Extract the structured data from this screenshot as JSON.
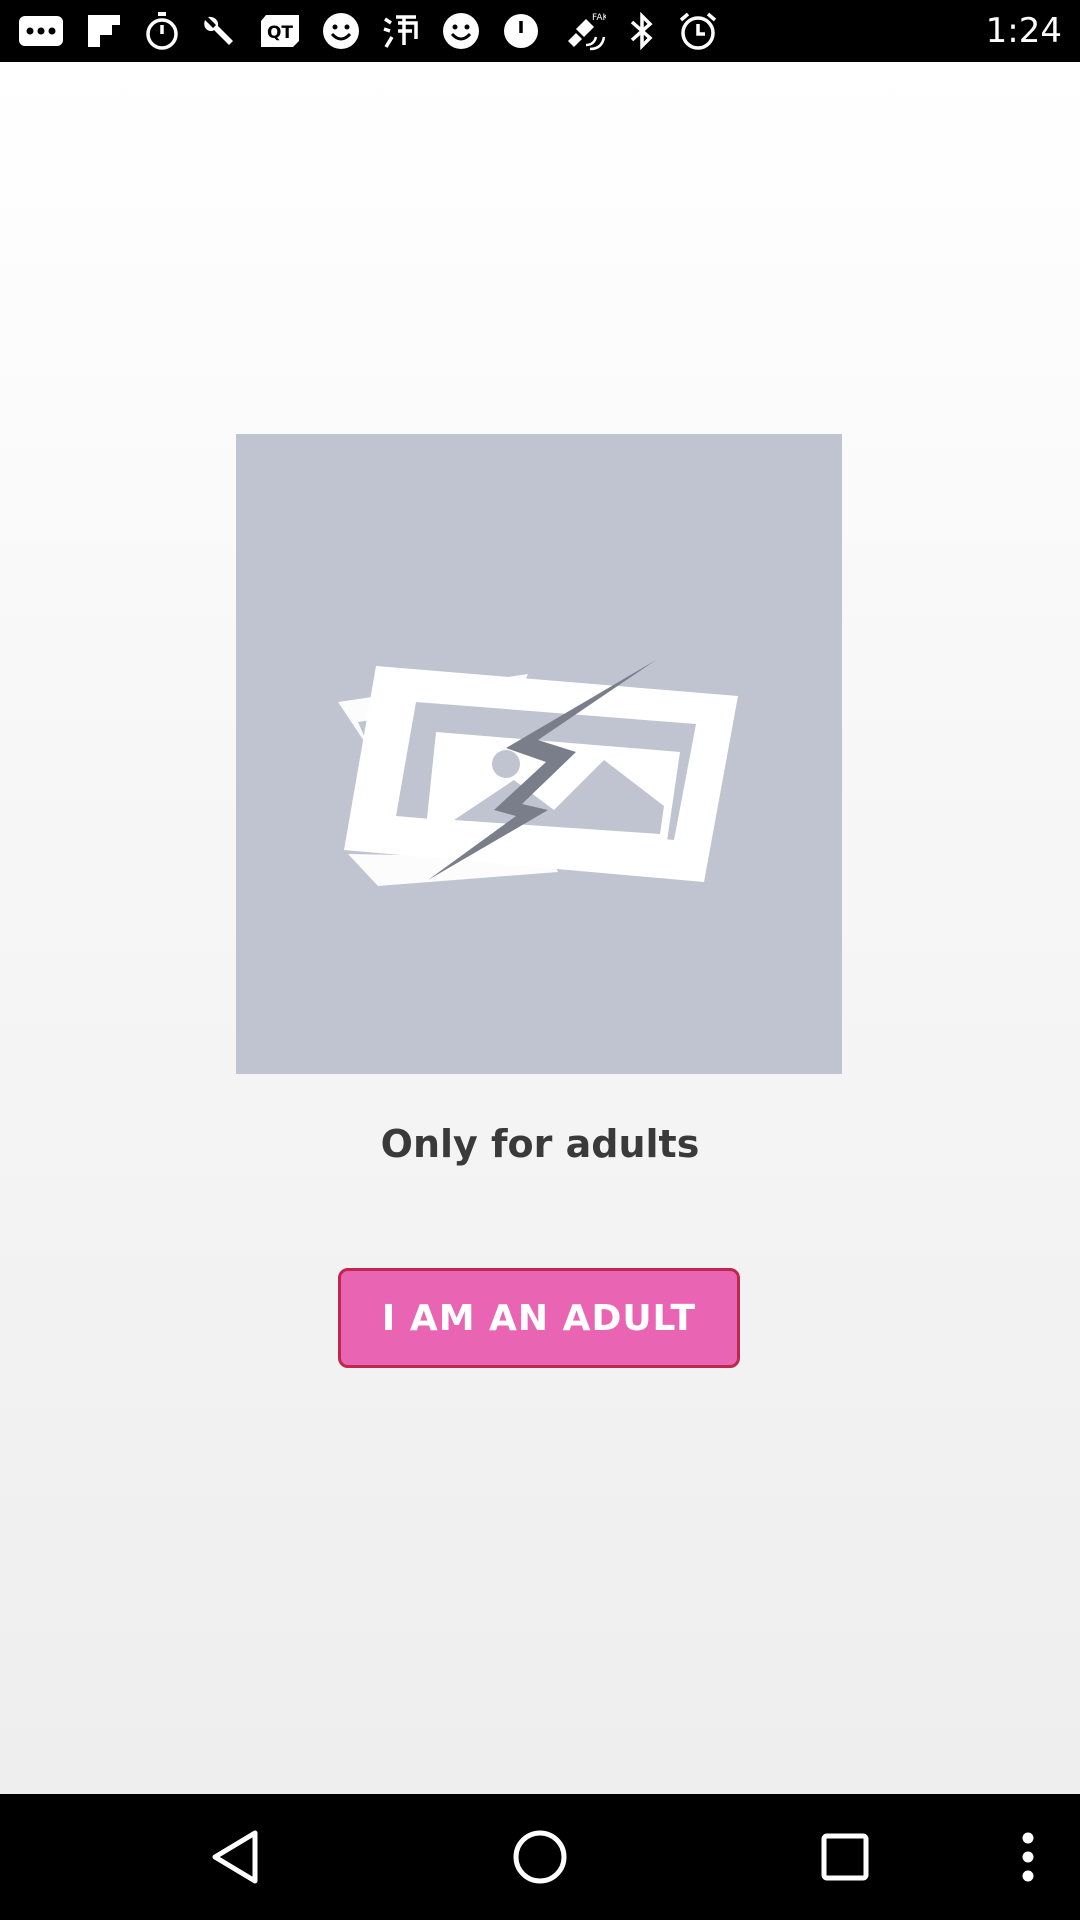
{
  "status_bar": {
    "time": "1:24",
    "icons": [
      "more-icon",
      "flipboard-icon",
      "stopwatch-icon",
      "wrench-icon",
      "qt-icon",
      "smiley-icon",
      "taobao-icon",
      "smiley-icon",
      "power-icon",
      "fake-gps-icon",
      "bluetooth-icon",
      "alarm-icon"
    ]
  },
  "content": {
    "headline": "Only for adults",
    "button_label": "I AM AN ADULT",
    "image_state": "broken-image-icon"
  },
  "nav_bar": {
    "icons": [
      "back-icon",
      "home-icon",
      "recents-icon",
      "menu-icon"
    ]
  },
  "colors": {
    "button_fill": "#ea64b4",
    "button_border": "#c0264e",
    "placeholder": "#c0c4d0"
  }
}
